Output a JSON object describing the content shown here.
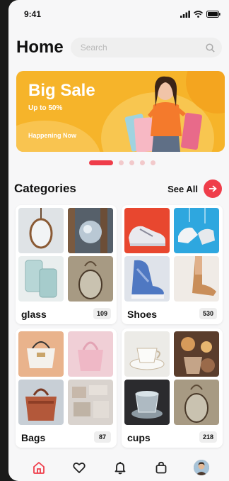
{
  "status": {
    "time": "9:41"
  },
  "header": {
    "title": "Home",
    "search_placeholder": "Search"
  },
  "banner": {
    "title": "Big Sale",
    "subtitle": "Up to 50%",
    "note": "Happening Now"
  },
  "carousel": {
    "count": 5,
    "active": 0
  },
  "categories": {
    "title": "Categories",
    "see_all_label": "See All",
    "items": [
      {
        "name": "glass",
        "count": "109"
      },
      {
        "name": "Shoes",
        "count": "530"
      },
      {
        "name": "Bags",
        "count": "87"
      },
      {
        "name": "cups",
        "count": "218"
      }
    ]
  },
  "bottom_nav": {
    "items": [
      {
        "icon": "home-icon",
        "active": true
      },
      {
        "icon": "heart-icon",
        "active": false
      },
      {
        "icon": "bell-icon",
        "active": false
      },
      {
        "icon": "bag-icon",
        "active": false
      },
      {
        "icon": "profile-avatar",
        "active": false
      }
    ]
  },
  "colors": {
    "accent": "#ef3d4a",
    "banner": "#f6b42a",
    "background": "#f7f7f8"
  }
}
